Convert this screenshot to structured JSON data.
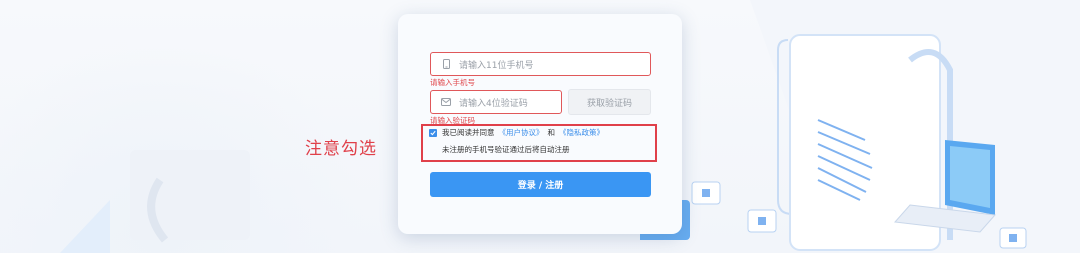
{
  "form": {
    "phone_placeholder": "请输入11位手机号",
    "phone_error": "请输入手机号",
    "code_placeholder": "请输入4位验证码",
    "code_error": "请输入验证码",
    "get_code_label": "获取验证码",
    "agree_prefix": "我已阅读并同意",
    "user_agreement": "《用户协议》",
    "and": "和",
    "privacy_policy": "《隐私政策》",
    "auto_register_note": "未注册的手机号验证通过后将自动注册",
    "submit_label": "登录 / 注册",
    "agree_checked": true
  },
  "annotation": {
    "text": "注意勾选",
    "color": "#e0404a"
  },
  "colors": {
    "accent": "#3a96f3",
    "error": "#e0464a"
  },
  "icons": {
    "phone": "mobile-phone-icon",
    "code": "envelope-icon",
    "checkbox": "checkmark-icon"
  }
}
